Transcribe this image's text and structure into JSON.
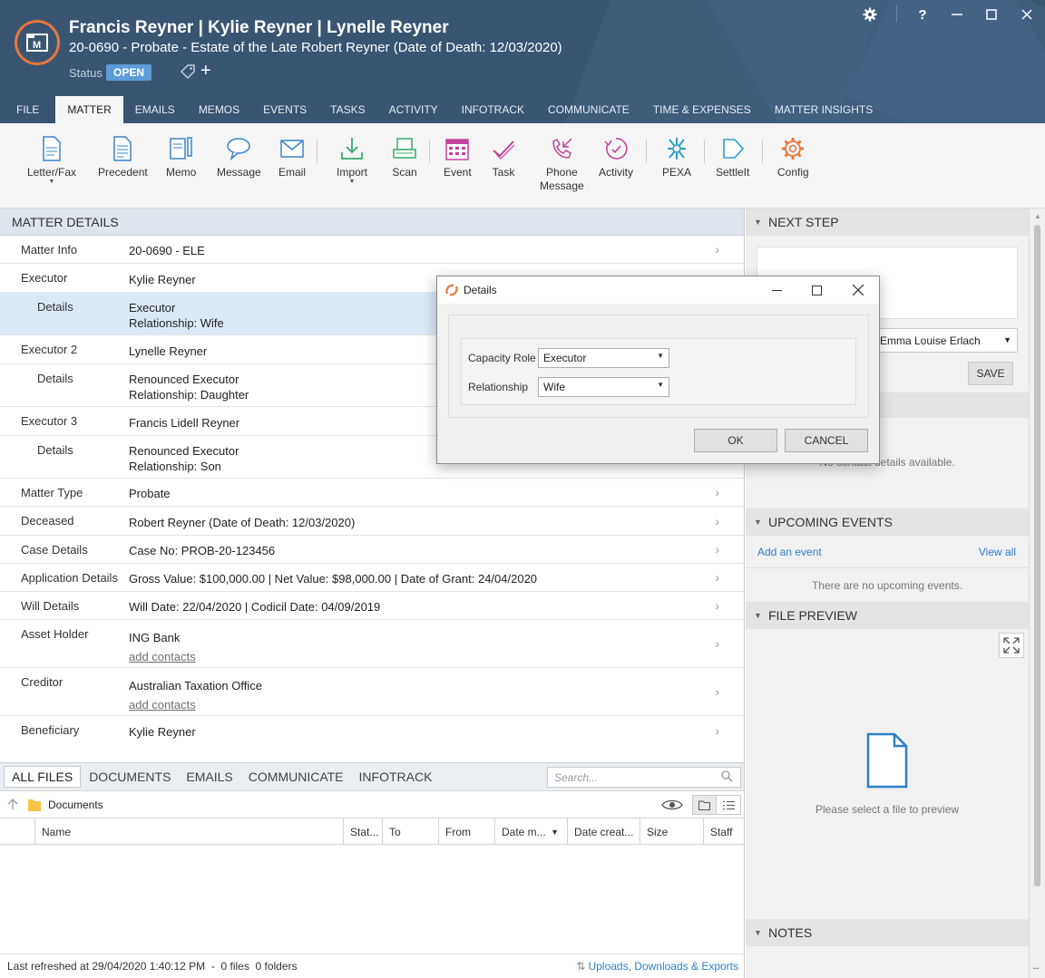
{
  "header": {
    "title": "Francis Reyner | Kylie Reyner | Lynelle Reyner",
    "subtitle": "20-0690 - Probate - Estate of the Late Robert Reyner (Date of Death: 12/03/2020)",
    "status_label": "Status",
    "status_value": "OPEN",
    "window_buttons": [
      "gear-icon",
      "help-icon",
      "minimize-icon",
      "maximize-icon",
      "close-icon"
    ],
    "help_label": "?"
  },
  "tabs": [
    "FILE",
    "MATTER",
    "EMAILS",
    "MEMOS",
    "EVENTS",
    "TASKS",
    "ACTIVITY",
    "INFOTRACK",
    "COMMUNICATE",
    "TIME & EXPENSES",
    "MATTER INSIGHTS"
  ],
  "ribbon": [
    {
      "label": "Letter/Fax",
      "icon": "letter-icon"
    },
    {
      "label": "Precedent",
      "icon": "precedent-icon"
    },
    {
      "label": "Memo",
      "icon": "memo-icon"
    },
    {
      "label": "Message",
      "icon": "message-icon"
    },
    {
      "label": "Email",
      "icon": "email-icon"
    },
    {
      "label": "Import",
      "icon": "import-icon"
    },
    {
      "label": "Scan",
      "icon": "scan-icon"
    },
    {
      "label": "Event",
      "icon": "calendar-icon"
    },
    {
      "label": "Task",
      "icon": "task-icon"
    },
    {
      "label": "Phone",
      "label2": "Message",
      "icon": "phone-icon"
    },
    {
      "label": "Activity",
      "icon": "activity-icon"
    },
    {
      "label": "PEXA",
      "icon": "pexa-icon"
    },
    {
      "label": "SettleIt",
      "icon": "settleit-icon"
    },
    {
      "label": "Config",
      "icon": "config-icon"
    }
  ],
  "matter_details": {
    "heading": "MATTER DETAILS",
    "rows": [
      {
        "key": "Matter Info",
        "value": "20-0690 - ELE"
      },
      {
        "key": "Executor",
        "value": "Kylie Reyner"
      },
      {
        "key": "Details",
        "value": "Executor",
        "value2": "Relationship: Wife"
      },
      {
        "key": "Executor 2",
        "value": "Lynelle Reyner"
      },
      {
        "key": "Details",
        "value": "Renounced Executor",
        "value2": "Relationship: Daughter"
      },
      {
        "key": "Executor 3",
        "value": "Francis Lidell Reyner"
      },
      {
        "key": "Details",
        "value": "Renounced Executor",
        "value2": "Relationship: Son"
      },
      {
        "key": "Matter Type",
        "value": "Probate"
      },
      {
        "key": "Deceased",
        "value": "Robert Reyner (Date of Death: 12/03/2020)"
      },
      {
        "key": "Case Details",
        "value": "Case No: PROB-20-123456"
      },
      {
        "key": "Application Details",
        "value": "Gross Value: $100,000.00 | Net Value: $98,000.00 | Date of Grant: 24/04/2020"
      },
      {
        "key": "Will Details",
        "value": "Will Date: 22/04/2020 | Codicil Date: 04/09/2019"
      },
      {
        "key": "Asset Holder",
        "value": "ING Bank",
        "value2": "add contacts"
      },
      {
        "key": "Creditor",
        "value": "Australian Taxation Office",
        "value2": "add contacts"
      },
      {
        "key": "Beneficiary",
        "value": "Kylie Reyner"
      }
    ]
  },
  "files": {
    "tabs": [
      "ALL FILES",
      "DOCUMENTS",
      "EMAILS",
      "COMMUNICATE",
      "INFOTRACK"
    ],
    "search_placeholder": "Search...",
    "folder": "Documents",
    "columns": [
      "Name",
      "Stat...",
      "To",
      "From",
      "Date m...",
      "Date creat...",
      "Size",
      "Staff"
    ],
    "status_text": "Last refreshed at 29/04/2020 1:40:12 PM  -  0 files  0 folders",
    "uploads_link": "Uploads, Downloads & Exports"
  },
  "side": {
    "next_step": "NEXT STEP",
    "staff_selected": "Emma Louise Erlach",
    "save": "SAVE",
    "no_contact": "No contact details available.",
    "upcoming_events": "UPCOMING EVENTS",
    "add_event": "Add an event",
    "view_all": "View all",
    "no_events": "There are no upcoming events.",
    "file_preview": "FILE PREVIEW",
    "preview_hint": "Please select a file to preview",
    "notes": "NOTES",
    "more": "..."
  },
  "dialog": {
    "title": "Details",
    "capacity_label": "Capacity Role",
    "capacity_value": "Executor",
    "relationship_label": "Relationship",
    "relationship_value": "Wife",
    "ok": "OK",
    "cancel": "CANCEL"
  },
  "colors": {
    "header_bg": "#3a5572",
    "accent_orange": "#e8763b",
    "status_badge": "#5d9bd9",
    "link_blue": "#2d7fc8",
    "highlight_row": "#dbe9f7"
  }
}
